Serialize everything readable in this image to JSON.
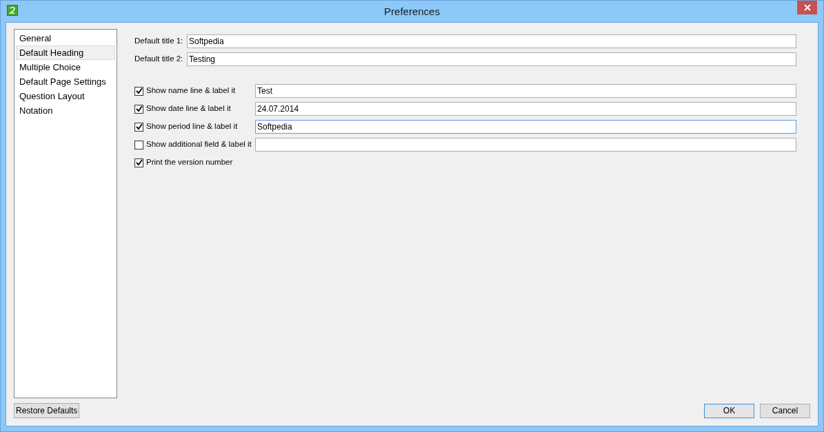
{
  "window": {
    "title": "Preferences"
  },
  "sidebar": {
    "items": [
      {
        "label": "General",
        "selected": false
      },
      {
        "label": "Default Heading",
        "selected": true
      },
      {
        "label": "Multiple Choice",
        "selected": false
      },
      {
        "label": "Default Page Settings",
        "selected": false
      },
      {
        "label": "Question Layout",
        "selected": false
      },
      {
        "label": "Notation",
        "selected": false
      }
    ]
  },
  "titles": [
    {
      "label": "Default title 1:",
      "value": "Softpedia"
    },
    {
      "label": "Default title 2:",
      "value": "Testing"
    }
  ],
  "options": [
    {
      "kind": "field",
      "label": "Show name line & label it",
      "checked": true,
      "value": "Test",
      "focused": false
    },
    {
      "kind": "field",
      "label": "Show date line & label it",
      "checked": true,
      "value": "24.07.2014",
      "focused": false
    },
    {
      "kind": "field",
      "label": "Show period line & label it",
      "checked": true,
      "value": "Softpedia",
      "focused": true
    },
    {
      "kind": "field",
      "label": "Show additional field & label it",
      "checked": false,
      "focused": false
    },
    {
      "kind": "plain",
      "label": "Print the version number",
      "checked": true
    }
  ],
  "buttons": {
    "restore": "Restore Defaults",
    "ok": "OK",
    "cancel": "Cancel"
  }
}
